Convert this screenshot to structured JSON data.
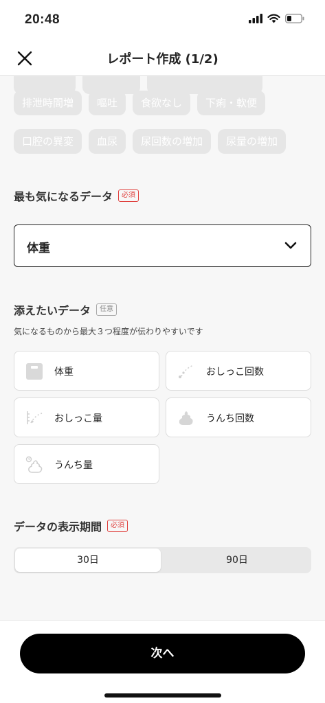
{
  "status_bar": {
    "time": "20:48"
  },
  "nav": {
    "title": "レポート作成 (1/2)"
  },
  "symptom_chips": {
    "row1": [
      "排泄時間増",
      "嘔吐",
      "食欲なし",
      "下痢・軟便"
    ],
    "row2": [
      "口腔の異変",
      "血尿",
      "尿回数の増加",
      "尿量の増加"
    ]
  },
  "main_data": {
    "title": "最も気になるデータ",
    "badge": "必須",
    "selected": "体重"
  },
  "additional_data": {
    "title": "添えたいデータ",
    "badge": "任意",
    "hint": "気になるものから最大３つ程度が伝わりやすいです",
    "options": [
      {
        "label": "体重",
        "icon": "weight-scale-icon"
      },
      {
        "label": "おしっこ回数",
        "icon": "pee-count-icon"
      },
      {
        "label": "おしっこ量",
        "icon": "pee-amount-icon"
      },
      {
        "label": "うんち回数",
        "icon": "poop-count-icon"
      },
      {
        "label": "うんち量",
        "icon": "poop-amount-icon"
      }
    ]
  },
  "period": {
    "title": "データの表示期間",
    "badge": "必須",
    "options": [
      "30日",
      "90日"
    ],
    "selected": "30日"
  },
  "footer": {
    "next_label": "次へ"
  },
  "colors": {
    "accent": "#000000",
    "required": "#e0413e",
    "chip_bg": "#e6e6e6"
  }
}
